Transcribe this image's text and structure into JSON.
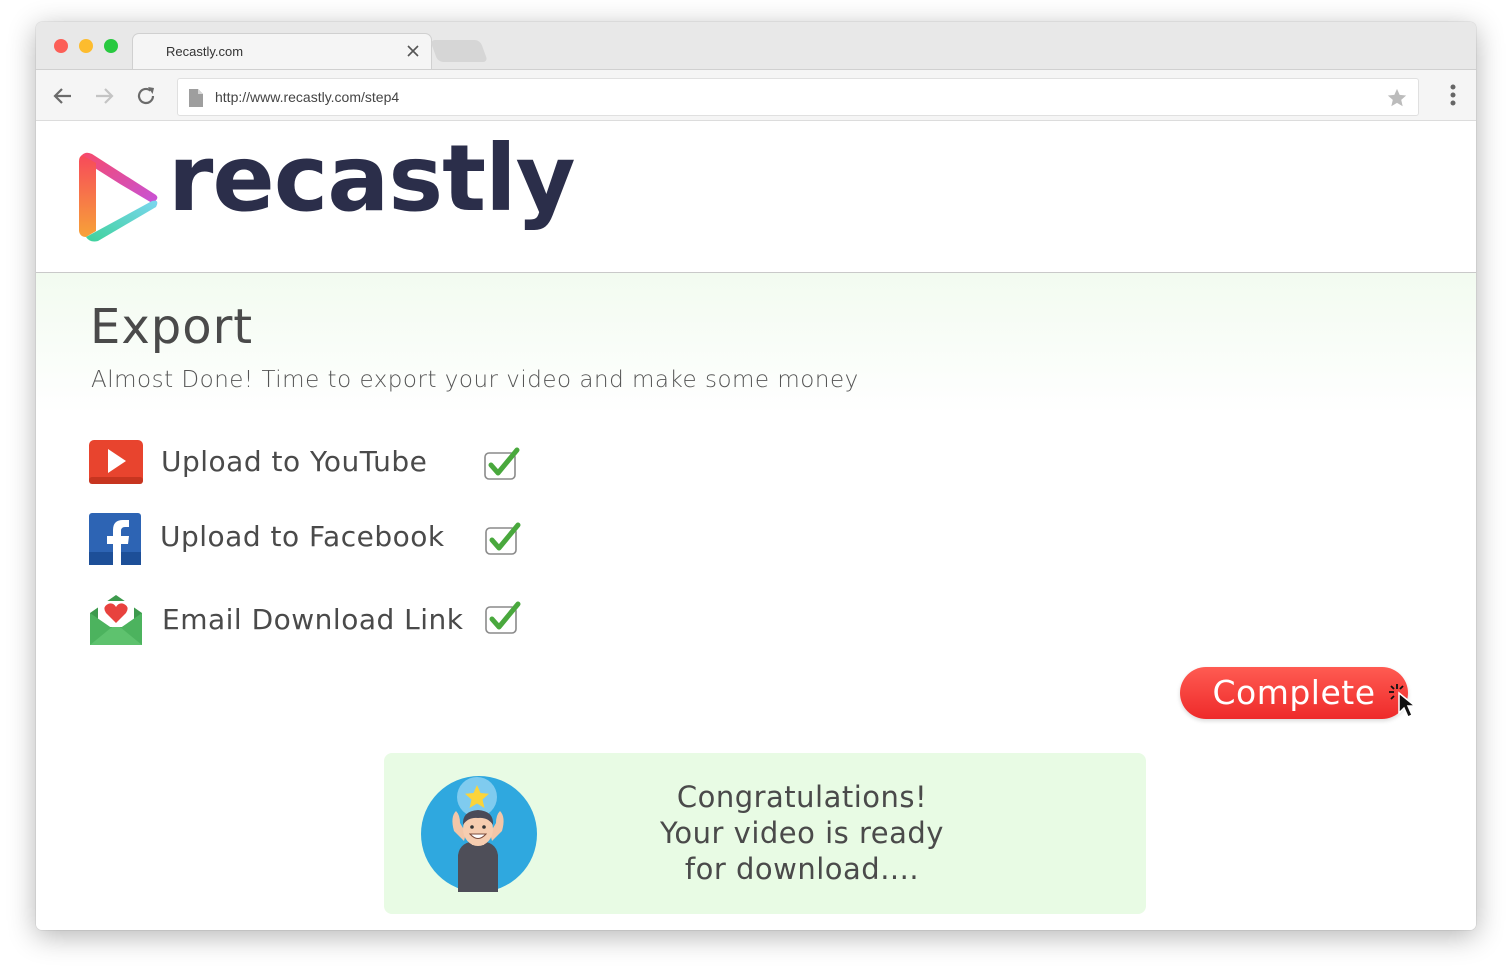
{
  "browser": {
    "tab_title": "Recastly.com",
    "url": "http://www.recastly.com/step4"
  },
  "brand": {
    "logo_text": "recastly",
    "text_color": "#2b2e4a"
  },
  "page": {
    "title": "Export",
    "subtitle": "Almost Done! Time to export your video and make some money"
  },
  "options": [
    {
      "label": "Upload to YouTube",
      "icon": "youtube-icon",
      "checked": true
    },
    {
      "label": "Upload to Facebook",
      "icon": "facebook-icon",
      "checked": true
    },
    {
      "label": "Email Download Link",
      "icon": "envelope-icon",
      "checked": true
    }
  ],
  "actions": {
    "complete_label": "Complete",
    "complete_color": "#f23a34"
  },
  "success": {
    "line1": "Congratulations!",
    "line2": "Your video is ready",
    "line3": "for download....",
    "background": "#e8fbe4"
  }
}
